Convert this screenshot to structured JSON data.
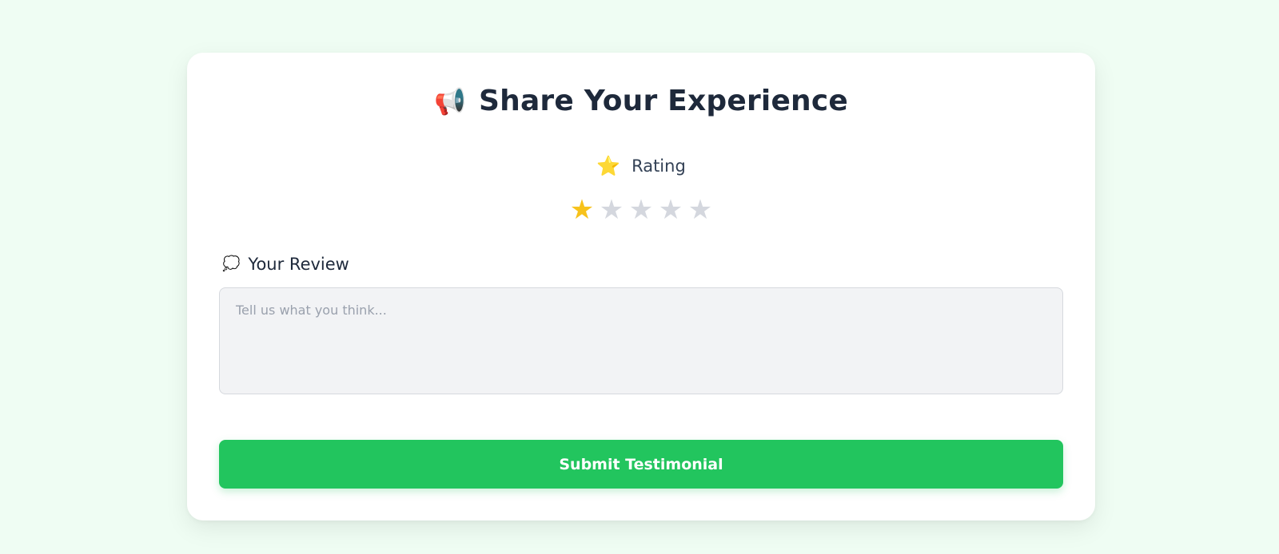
{
  "form": {
    "title": "Share Your Experience",
    "title_icon": "megaphone-icon",
    "title_icon_glyph": "📢",
    "rating": {
      "label": "Rating",
      "icon": "star-icon",
      "icon_glyph": "⭐",
      "value": 1,
      "max": 5,
      "stars": [
        "★",
        "★",
        "★",
        "★",
        "★"
      ]
    },
    "review": {
      "label": "Your Review",
      "icon": "speech-bubble-icon",
      "icon_glyph": "💭",
      "value": "",
      "placeholder": "Tell us what you think..."
    },
    "submit_label": "Submit Testimonial"
  },
  "colors": {
    "background": "#effdf3",
    "accent": "#22c55e",
    "star_active": "#f7c21b",
    "star_inactive": "#d4d7de",
    "heading": "#1e293b"
  }
}
